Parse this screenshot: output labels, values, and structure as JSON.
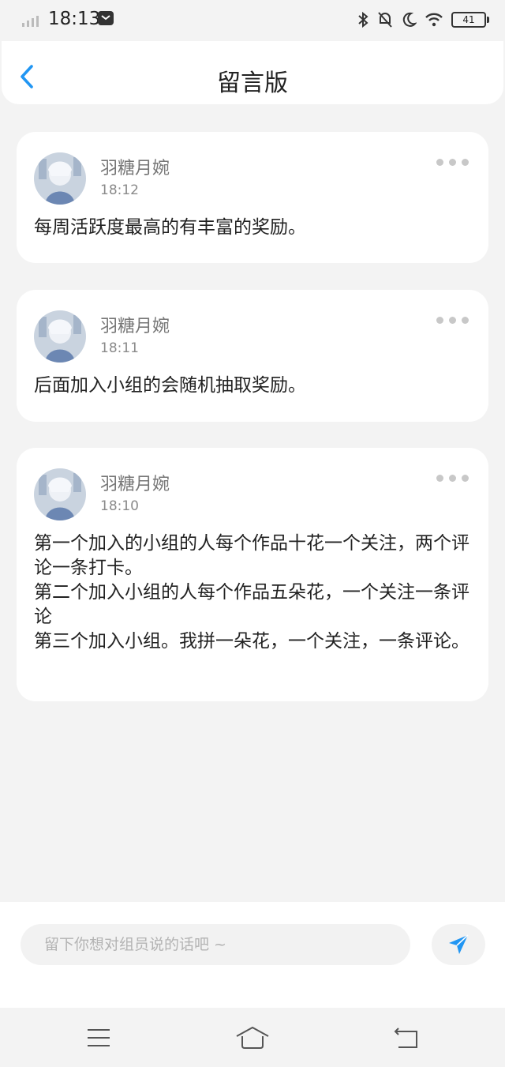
{
  "status_bar": {
    "time": "18:13",
    "battery": "41"
  },
  "header": {
    "title": "留言版"
  },
  "messages": [
    {
      "name": "羽糖月婉",
      "time": "18:12",
      "text": "每周活跃度最高的有丰富的奖励。"
    },
    {
      "name": "羽糖月婉",
      "time": "18:11",
      "text": "后面加入小组的会随机抽取奖励。"
    },
    {
      "name": "羽糖月婉",
      "time": "18:10",
      "text": "第一个加入的小组的人每个作品十花一个关注，两个评论一条打卡。\n第二个加入小组的人每个作品五朵花，一个关注一条评论\n第三个加入小组。我拼一朵花，一个关注，一条评论。"
    }
  ],
  "composer": {
    "placeholder": "留下你想对组员说的话吧 ~"
  },
  "colors": {
    "accent": "#2196f3",
    "background": "#f3f3f3",
    "card": "#ffffff"
  },
  "icons": [
    "back-arrow-icon",
    "more-dots-icon",
    "send-icon",
    "menu-icon",
    "home-icon",
    "return-icon"
  ]
}
